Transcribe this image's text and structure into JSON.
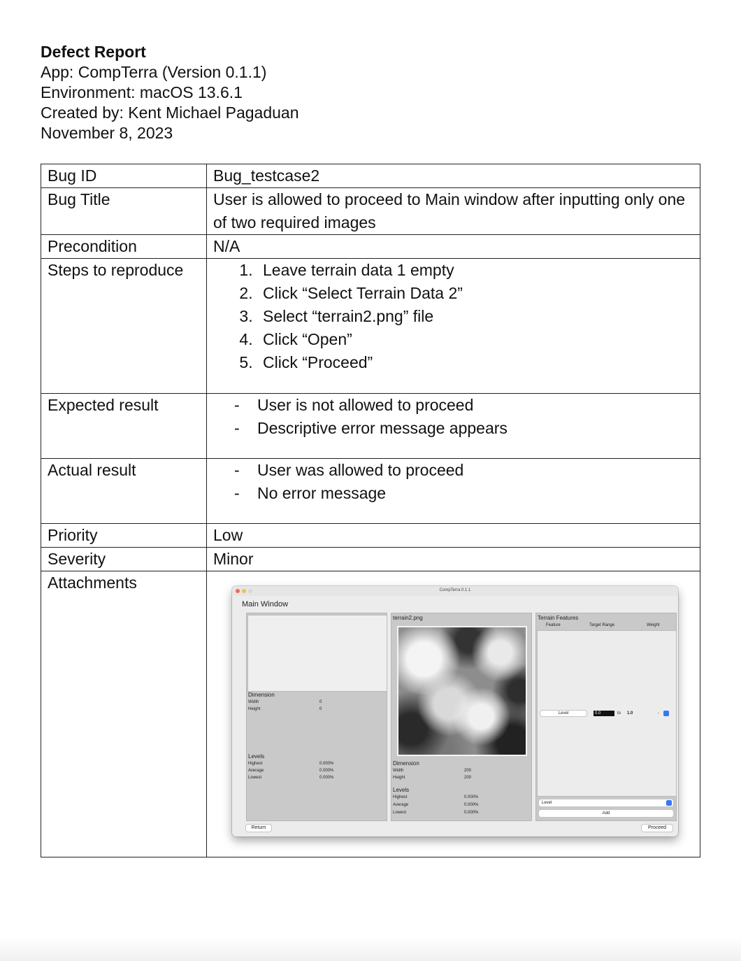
{
  "header": {
    "title": "Defect Report",
    "app": "App: CompTerra (Version 0.1.1)",
    "environment": "Environment: macOS 13.6.1",
    "created_by": "Created by: Kent Michael Pagaduan",
    "date": "November 8, 2023"
  },
  "report": {
    "bug_id": {
      "label": "Bug ID",
      "value": "Bug_testcase2"
    },
    "bug_title": {
      "label": "Bug Title",
      "value": "User is allowed to proceed to Main window after inputting only one of two required images"
    },
    "precondition": {
      "label": "Precondition",
      "value": "N/A"
    },
    "steps": {
      "label": "Steps to reproduce",
      "items": [
        "Leave terrain data 1 empty",
        "Click “Select Terrain Data 2”",
        "Select “terrain2.png” file",
        "Click “Open”",
        "Click “Proceed”"
      ]
    },
    "expected": {
      "label": "Expected result",
      "items": [
        "User is not allowed to proceed",
        "Descriptive error message appears"
      ]
    },
    "actual": {
      "label": "Actual result",
      "items": [
        "User was allowed to proceed",
        "No error message"
      ]
    },
    "priority": {
      "label": "Priority",
      "value": "Low"
    },
    "severity": {
      "label": "Severity",
      "value": "Minor"
    },
    "attachments": {
      "label": "Attachments"
    }
  },
  "screenshot": {
    "window_title": "CompTerra 0.1.1",
    "main_label": "Main Window",
    "left_panel": {
      "dimension_title": "Dimension",
      "width_label": "Width",
      "width_value": "0",
      "height_label": "Height",
      "height_value": "0",
      "levels_title": "Levels",
      "highest_label": "Highest",
      "highest_value": "0.000%",
      "average_label": "Average",
      "average_value": "0.000%",
      "lowest_label": "Lowest",
      "lowest_value": "0.000%",
      "return_button": "Return"
    },
    "middle_panel": {
      "filename": "terrain2.png",
      "dimension_title": "Dimension",
      "width_label": "Width",
      "width_value": "200",
      "height_label": "Height",
      "height_value": "200",
      "levels_title": "Levels",
      "highest_label": "Highest",
      "highest_value": "0.000%",
      "average_label": "Average",
      "average_value": "0.000%",
      "lowest_label": "Lowest",
      "lowest_value": "0.000%"
    },
    "right_panel": {
      "title": "Terrain Features",
      "col_feature": "Feature",
      "col_target": "Target Range",
      "col_weight": "Weight",
      "row_feature": "Level",
      "row_from": "0.0",
      "row_to_label": "to",
      "row_to": "1.0",
      "row_weight": "-",
      "select_value": "Level",
      "add_button": "Add",
      "proceed_button": "Proceed"
    },
    "colors": {
      "close": "#ed6a5e",
      "minimize": "#f5bf4f",
      "zoom": "#d6d6d6",
      "select_accent": "#3478f6"
    }
  }
}
